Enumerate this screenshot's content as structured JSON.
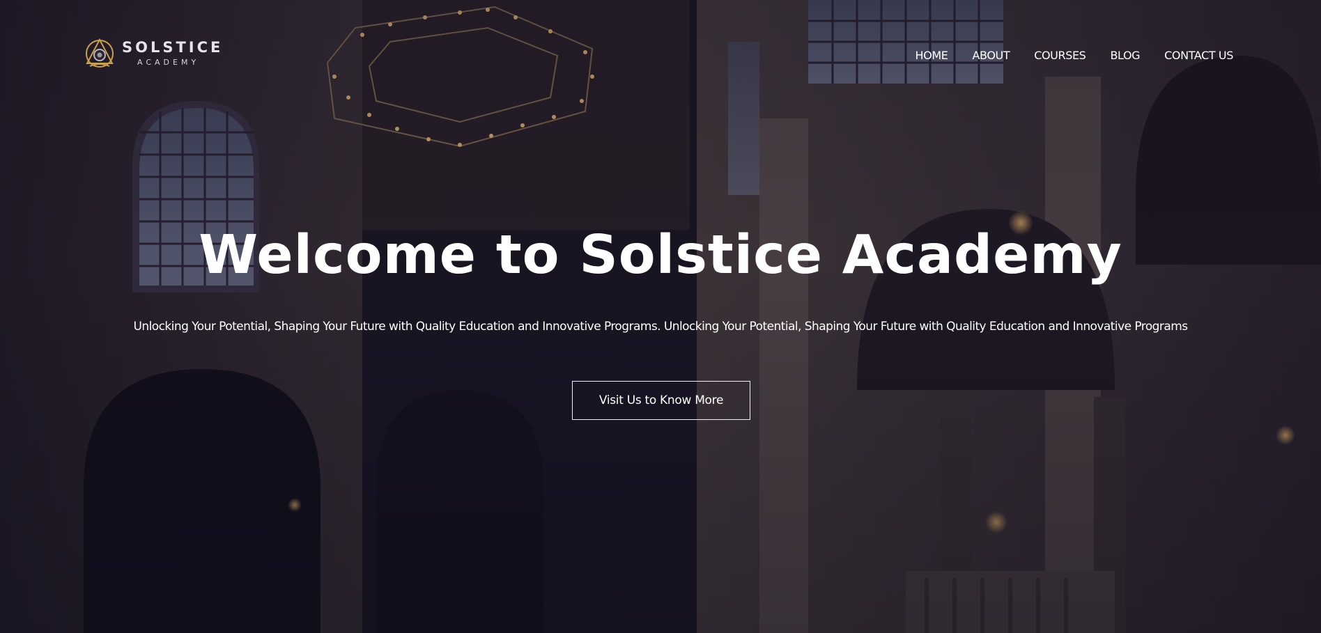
{
  "brand": {
    "name": "SOLSTICE",
    "sub": "ACADEMY",
    "accent_color": "#c9a24a"
  },
  "nav": {
    "items": [
      {
        "label": "HOME"
      },
      {
        "label": "ABOUT"
      },
      {
        "label": "COURSES"
      },
      {
        "label": "BLOG"
      },
      {
        "label": "CONTACT US"
      }
    ]
  },
  "hero": {
    "title": "Welcome to Solstice Academy",
    "subtitle": "Unlocking Your Potential, Shaping Your Future with Quality Education and Innovative Programs. Unlocking Your Potential, Shaping Your Future with Quality Education and Innovative Programs",
    "cta_label": "Visit Us to Know More"
  },
  "icons": {
    "logo": "academy-emblem-icon"
  }
}
